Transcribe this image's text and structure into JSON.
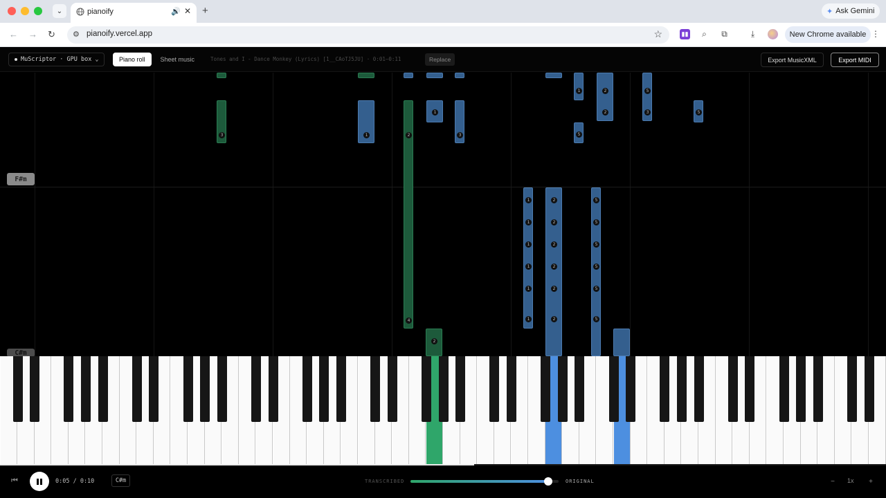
{
  "browser": {
    "tab_title": "pianoify",
    "url": "pianoify.vercel.app",
    "gemini_label": "Ask Gemini",
    "update_label": "New Chrome available"
  },
  "toolbar": {
    "model_label": "MuScriptor · GPU box",
    "view_tabs": [
      "Piano roll",
      "Sheet music"
    ],
    "active_view": "Piano roll",
    "song_title": "Tones and I - Dance Monkey (Lyrics) [1__CAoTJ5JU] · 0:01–0:11",
    "replace_label": "Replace",
    "export_xml_label": "Export MusicXML",
    "export_midi_label": "Export MIDI"
  },
  "roll": {
    "chord_labels": [
      "F#m",
      "C#m"
    ],
    "colors": {
      "transcribed": "#2fa66a",
      "original": "#4d8fe0"
    }
  },
  "transport": {
    "time": "0:05 / 0:10",
    "key": "C#m",
    "mix_left_label": "TRANSCRIBED",
    "mix_right_label": "ORIGINAL",
    "mix_value": 0.93,
    "playback_progress": 0.5,
    "speed": "1x",
    "zoom_out": "−",
    "zoom_in": "+"
  }
}
